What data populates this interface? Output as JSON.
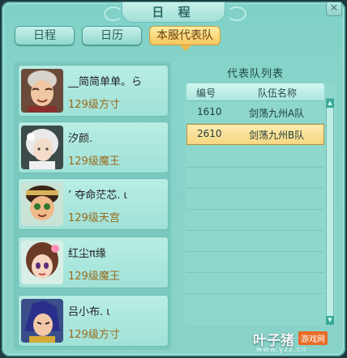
{
  "window": {
    "title": "日 程",
    "close_label": "✕"
  },
  "tabs": [
    {
      "label": "日程"
    },
    {
      "label": "日历"
    },
    {
      "label": "本服代表队"
    }
  ],
  "members": [
    {
      "name": "__简简单单。ら",
      "level": "129级方寸",
      "avatar": "elder-woman-portrait"
    },
    {
      "name": "汐颜.",
      "level": "129级魔王",
      "avatar": "white-haired-portrait"
    },
    {
      "name": "’ 夺命茫芯. ι",
      "level": "129级天宫",
      "avatar": "boy-portrait"
    },
    {
      "name": "红尘π缘",
      "level": "129级魔王",
      "avatar": "girl-portrait"
    },
    {
      "name": "吕小布. ι",
      "level": "129级方寸",
      "avatar": "blue-haired-portrait"
    }
  ],
  "team_list": {
    "title": "代表队列表",
    "columns": [
      "编号",
      "队伍名称"
    ],
    "rows": [
      {
        "id": "1610",
        "name": "剑荡九州A队",
        "selected": false
      },
      {
        "id": "2610",
        "name": "剑荡九州B队",
        "selected": true
      }
    ]
  },
  "watermark": {
    "main": "叶子猪",
    "badge": "游戏网",
    "url": "www.yzz.cn"
  }
}
